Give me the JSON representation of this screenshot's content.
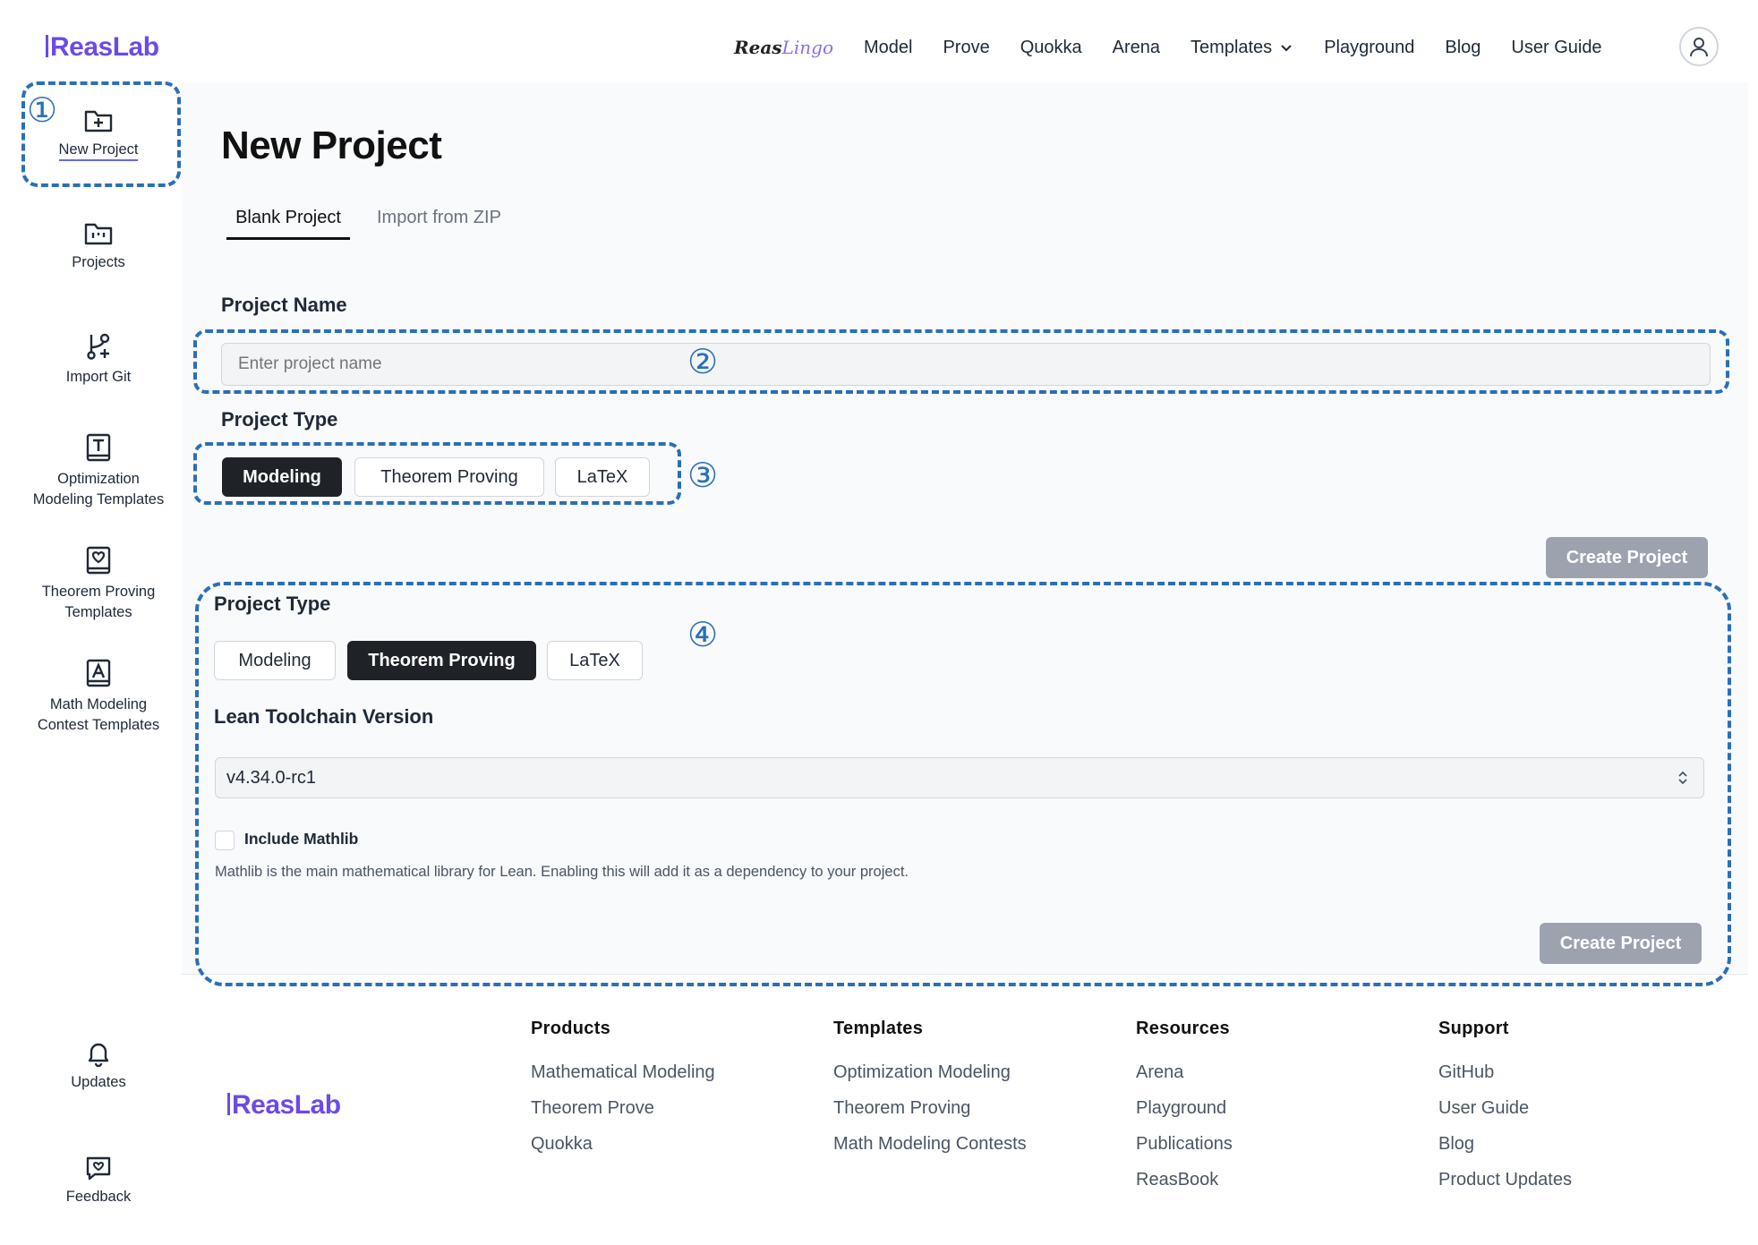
{
  "header": {
    "logo": "ReasLab",
    "nav_brand_prefix": "Reas",
    "nav_brand_suffix": "Lingo",
    "nav": [
      "Model",
      "Prove",
      "Quokka",
      "Arena",
      "Templates",
      "Playground",
      "Blog",
      "User Guide"
    ]
  },
  "sidebar": {
    "items": [
      {
        "label": "New Project",
        "icon": "folder-plus-icon"
      },
      {
        "label": "Projects",
        "icon": "folder-kanban-icon"
      },
      {
        "label": "Import Git",
        "icon": "git-branch-plus-icon"
      },
      {
        "label1": "Optimization",
        "label2": "Modeling Templates",
        "icon": "template-t-icon"
      },
      {
        "label1": "Theorem Proving",
        "label2": "Templates",
        "icon": "template-check-icon"
      },
      {
        "label1": "Math Modeling",
        "label2": "Contest Templates",
        "icon": "template-a-icon"
      }
    ],
    "bottom": [
      {
        "label": "Updates",
        "icon": "bell-icon"
      },
      {
        "label": "Feedback",
        "icon": "message-heart-icon"
      }
    ]
  },
  "main": {
    "title": "New Project",
    "tabs": [
      "Blank Project",
      "Import from ZIP"
    ],
    "project_name_label": "Project Name",
    "project_name_placeholder": "Enter project name",
    "project_type_label": "Project Type",
    "types": [
      "Modeling",
      "Theorem Proving",
      "LaTeX"
    ],
    "create_button": "Create Project",
    "lean_label": "Lean Toolchain Version",
    "lean_version": "v4.34.0-rc1",
    "mathlib_label": "Include Mathlib",
    "mathlib_hint": "Mathlib is the main mathematical library for Lean. Enabling this will add it as a dependency to your project."
  },
  "annotations": [
    "①",
    "②",
    "③",
    "④"
  ],
  "footer": {
    "logo": "ReasLab",
    "columns": [
      {
        "head": "Products",
        "links": [
          "Mathematical Modeling",
          "Theorem Prove",
          "Quokka"
        ]
      },
      {
        "head": "Templates",
        "links": [
          "Optimization Modeling",
          "Theorem Proving",
          "Math Modeling Contests"
        ]
      },
      {
        "head": "Resources",
        "links": [
          "Arena",
          "Playground",
          "Publications",
          "ReasBook"
        ]
      },
      {
        "head": "Support",
        "links": [
          "GitHub",
          "User Guide",
          "Blog",
          "Product Updates"
        ]
      }
    ]
  },
  "colors": {
    "brand": "#6d4ae8",
    "annotation": "#2a6fb9",
    "active_pill": "#1f2328",
    "disabled_button": "#9ca3af"
  }
}
